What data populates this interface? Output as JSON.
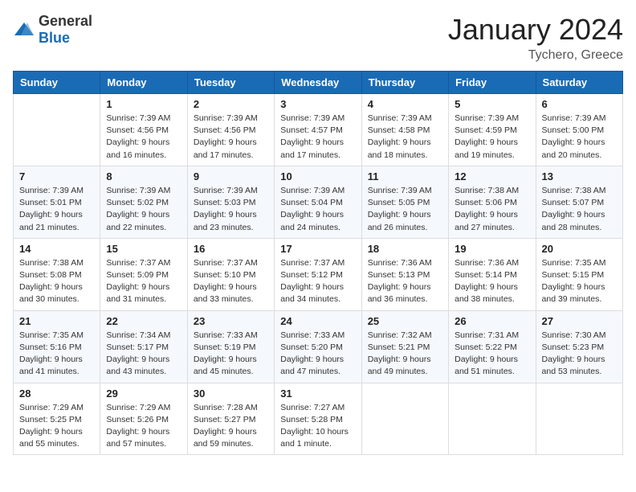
{
  "header": {
    "logo_general": "General",
    "logo_blue": "Blue",
    "month_title": "January 2024",
    "location": "Tychero, Greece"
  },
  "days_of_week": [
    "Sunday",
    "Monday",
    "Tuesday",
    "Wednesday",
    "Thursday",
    "Friday",
    "Saturday"
  ],
  "weeks": [
    [
      {
        "day": "",
        "content": ""
      },
      {
        "day": "1",
        "content": "Sunrise: 7:39 AM\nSunset: 4:56 PM\nDaylight: 9 hours\nand 16 minutes."
      },
      {
        "day": "2",
        "content": "Sunrise: 7:39 AM\nSunset: 4:56 PM\nDaylight: 9 hours\nand 17 minutes."
      },
      {
        "day": "3",
        "content": "Sunrise: 7:39 AM\nSunset: 4:57 PM\nDaylight: 9 hours\nand 17 minutes."
      },
      {
        "day": "4",
        "content": "Sunrise: 7:39 AM\nSunset: 4:58 PM\nDaylight: 9 hours\nand 18 minutes."
      },
      {
        "day": "5",
        "content": "Sunrise: 7:39 AM\nSunset: 4:59 PM\nDaylight: 9 hours\nand 19 minutes."
      },
      {
        "day": "6",
        "content": "Sunrise: 7:39 AM\nSunset: 5:00 PM\nDaylight: 9 hours\nand 20 minutes."
      }
    ],
    [
      {
        "day": "7",
        "content": "Sunrise: 7:39 AM\nSunset: 5:01 PM\nDaylight: 9 hours\nand 21 minutes."
      },
      {
        "day": "8",
        "content": "Sunrise: 7:39 AM\nSunset: 5:02 PM\nDaylight: 9 hours\nand 22 minutes."
      },
      {
        "day": "9",
        "content": "Sunrise: 7:39 AM\nSunset: 5:03 PM\nDaylight: 9 hours\nand 23 minutes."
      },
      {
        "day": "10",
        "content": "Sunrise: 7:39 AM\nSunset: 5:04 PM\nDaylight: 9 hours\nand 24 minutes."
      },
      {
        "day": "11",
        "content": "Sunrise: 7:39 AM\nSunset: 5:05 PM\nDaylight: 9 hours\nand 26 minutes."
      },
      {
        "day": "12",
        "content": "Sunrise: 7:38 AM\nSunset: 5:06 PM\nDaylight: 9 hours\nand 27 minutes."
      },
      {
        "day": "13",
        "content": "Sunrise: 7:38 AM\nSunset: 5:07 PM\nDaylight: 9 hours\nand 28 minutes."
      }
    ],
    [
      {
        "day": "14",
        "content": "Sunrise: 7:38 AM\nSunset: 5:08 PM\nDaylight: 9 hours\nand 30 minutes."
      },
      {
        "day": "15",
        "content": "Sunrise: 7:37 AM\nSunset: 5:09 PM\nDaylight: 9 hours\nand 31 minutes."
      },
      {
        "day": "16",
        "content": "Sunrise: 7:37 AM\nSunset: 5:10 PM\nDaylight: 9 hours\nand 33 minutes."
      },
      {
        "day": "17",
        "content": "Sunrise: 7:37 AM\nSunset: 5:12 PM\nDaylight: 9 hours\nand 34 minutes."
      },
      {
        "day": "18",
        "content": "Sunrise: 7:36 AM\nSunset: 5:13 PM\nDaylight: 9 hours\nand 36 minutes."
      },
      {
        "day": "19",
        "content": "Sunrise: 7:36 AM\nSunset: 5:14 PM\nDaylight: 9 hours\nand 38 minutes."
      },
      {
        "day": "20",
        "content": "Sunrise: 7:35 AM\nSunset: 5:15 PM\nDaylight: 9 hours\nand 39 minutes."
      }
    ],
    [
      {
        "day": "21",
        "content": "Sunrise: 7:35 AM\nSunset: 5:16 PM\nDaylight: 9 hours\nand 41 minutes."
      },
      {
        "day": "22",
        "content": "Sunrise: 7:34 AM\nSunset: 5:17 PM\nDaylight: 9 hours\nand 43 minutes."
      },
      {
        "day": "23",
        "content": "Sunrise: 7:33 AM\nSunset: 5:19 PM\nDaylight: 9 hours\nand 45 minutes."
      },
      {
        "day": "24",
        "content": "Sunrise: 7:33 AM\nSunset: 5:20 PM\nDaylight: 9 hours\nand 47 minutes."
      },
      {
        "day": "25",
        "content": "Sunrise: 7:32 AM\nSunset: 5:21 PM\nDaylight: 9 hours\nand 49 minutes."
      },
      {
        "day": "26",
        "content": "Sunrise: 7:31 AM\nSunset: 5:22 PM\nDaylight: 9 hours\nand 51 minutes."
      },
      {
        "day": "27",
        "content": "Sunrise: 7:30 AM\nSunset: 5:23 PM\nDaylight: 9 hours\nand 53 minutes."
      }
    ],
    [
      {
        "day": "28",
        "content": "Sunrise: 7:29 AM\nSunset: 5:25 PM\nDaylight: 9 hours\nand 55 minutes."
      },
      {
        "day": "29",
        "content": "Sunrise: 7:29 AM\nSunset: 5:26 PM\nDaylight: 9 hours\nand 57 minutes."
      },
      {
        "day": "30",
        "content": "Sunrise: 7:28 AM\nSunset: 5:27 PM\nDaylight: 9 hours\nand 59 minutes."
      },
      {
        "day": "31",
        "content": "Sunrise: 7:27 AM\nSunset: 5:28 PM\nDaylight: 10 hours\nand 1 minute."
      },
      {
        "day": "",
        "content": ""
      },
      {
        "day": "",
        "content": ""
      },
      {
        "day": "",
        "content": ""
      }
    ]
  ]
}
